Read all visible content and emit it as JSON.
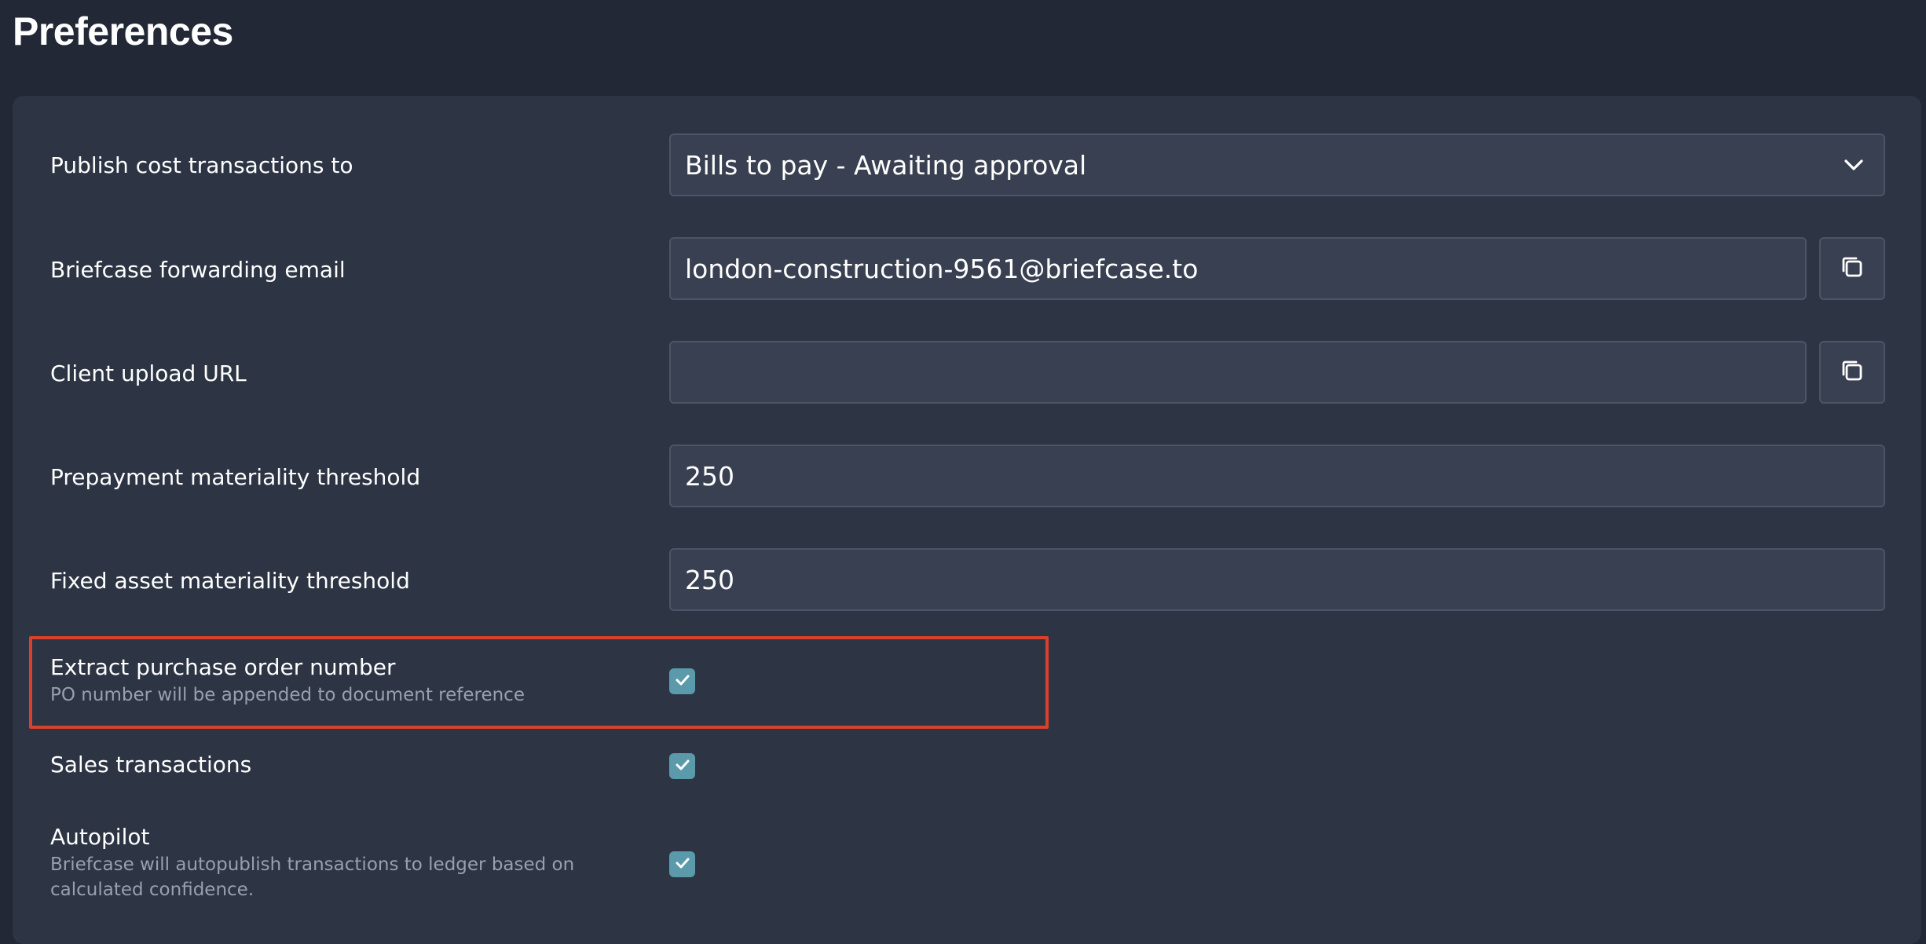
{
  "page": {
    "title": "Preferences"
  },
  "settings": {
    "publish_cost": {
      "label": "Publish cost transactions to",
      "value": "Bills to pay - Awaiting approval",
      "icon": "chevron-down-icon"
    },
    "forwarding_email": {
      "label": "Briefcase forwarding email",
      "value": "london-construction-9561@briefcase.to",
      "icon": "copy-icon"
    },
    "client_upload_url": {
      "label": "Client upload URL",
      "value": "",
      "icon": "copy-icon"
    },
    "prepayment_threshold": {
      "label": "Prepayment materiality threshold",
      "value": "250"
    },
    "fixed_asset_threshold": {
      "label": "Fixed asset materiality threshold",
      "value": "250"
    },
    "extract_po": {
      "label": "Extract purchase order number",
      "description": "PO number will be appended to document reference",
      "checked": true
    },
    "sales_transactions": {
      "label": "Sales transactions",
      "checked": true
    },
    "autopilot": {
      "label": "Autopilot",
      "description_line1": "Briefcase will autopublish transactions to ledger based on",
      "description_line2": "calculated confidence.",
      "checked": true
    }
  },
  "colors": {
    "background": "#222835",
    "panel": "#2d3444",
    "field": "#394051",
    "field_border": "#4c5466",
    "checkbox": "#5b9aaa",
    "highlight": "#d8412b",
    "secondary_text": "#98a0ae"
  }
}
